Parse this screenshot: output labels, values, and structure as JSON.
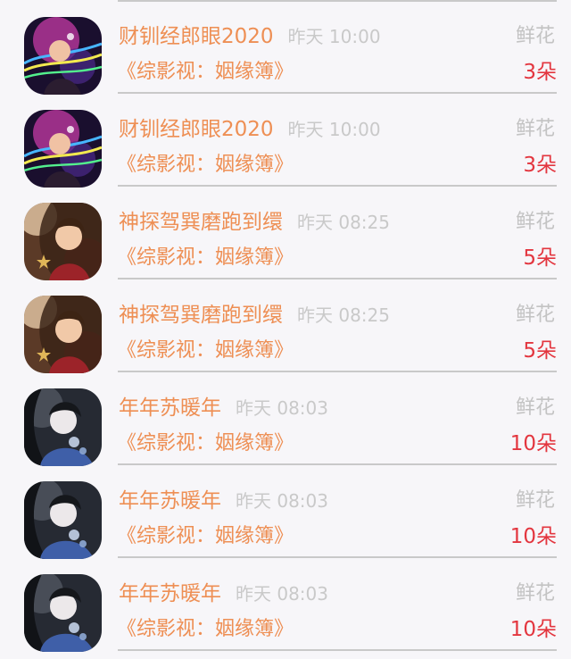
{
  "records": [
    {
      "user": "财钏经郎眼2020",
      "time": "昨天 10:00",
      "show": "《综影视：姻缘簿》",
      "gift": "鲜花",
      "count": "3朵",
      "avatar_style": "neon"
    },
    {
      "user": "财钏经郎眼2020",
      "time": "昨天 10:00",
      "show": "《综影视：姻缘簿》",
      "gift": "鲜花",
      "count": "3朵",
      "avatar_style": "neon"
    },
    {
      "user": "神探驾巽磨跑到缳",
      "time": "昨天 08:25",
      "show": "《综影视：姻缘簿》",
      "gift": "鲜花",
      "count": "5朵",
      "avatar_style": "warm"
    },
    {
      "user": "神探驾巽磨跑到缳",
      "time": "昨天 08:25",
      "show": "《综影视：姻缘簿》",
      "gift": "鲜花",
      "count": "5朵",
      "avatar_style": "warm"
    },
    {
      "user": "年年苏暖年",
      "time": "昨天 08:03",
      "show": "《综影视：姻缘簿》",
      "gift": "鲜花",
      "count": "10朵",
      "avatar_style": "blue"
    },
    {
      "user": "年年苏暖年",
      "time": "昨天 08:03",
      "show": "《综影视：姻缘簿》",
      "gift": "鲜花",
      "count": "10朵",
      "avatar_style": "blue"
    },
    {
      "user": "年年苏暖年",
      "time": "昨天 08:03",
      "show": "《综影视：姻缘簿》",
      "gift": "鲜花",
      "count": "10朵",
      "avatar_style": "blue"
    }
  ],
  "colors": {
    "accent": "#ee8f54",
    "count": "#e3363f",
    "muted": "#c9c9c9",
    "background": "#f7f6f9"
  }
}
